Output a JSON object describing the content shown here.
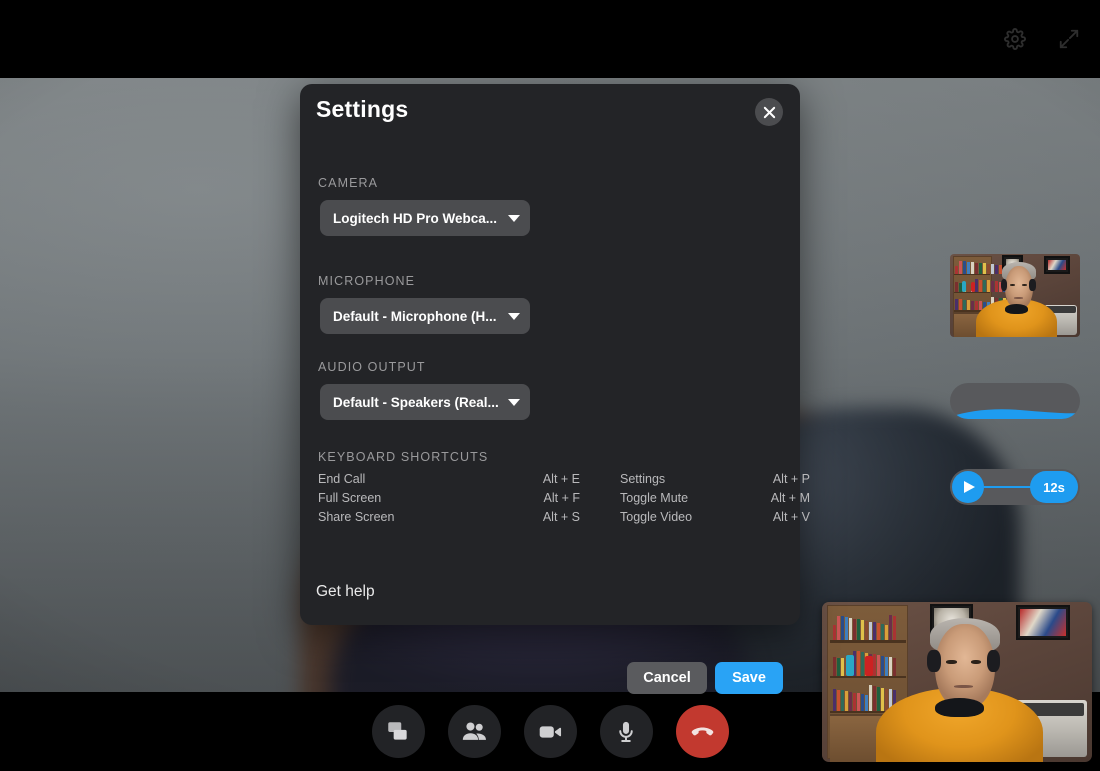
{
  "window": {
    "topbar": {
      "settings_icon": "gear-icon",
      "fullscreen_icon": "expand-arrows-icon"
    }
  },
  "call_controls": [
    {
      "name": "share-screen",
      "icon": "screen-share-icon",
      "label": "Share Screen",
      "style": "default"
    },
    {
      "name": "participants",
      "icon": "people-icon",
      "label": "Participants",
      "style": "default"
    },
    {
      "name": "toggle-video",
      "icon": "video-camera-icon",
      "label": "Toggle Video",
      "style": "default"
    },
    {
      "name": "toggle-mute",
      "icon": "microphone-icon",
      "label": "Toggle Mute",
      "style": "default"
    },
    {
      "name": "end-call",
      "icon": "phone-hangup-icon",
      "label": "End Call",
      "style": "danger"
    }
  ],
  "modal": {
    "title": "Settings",
    "close_label": "×",
    "close_icon": "close-icon",
    "camera": {
      "label": "CAMERA",
      "selected": "Logitech HD Pro Webca...",
      "caret_icon": "chevron-down-icon",
      "preview_name": "camera-preview"
    },
    "microphone": {
      "label": "MICROPHONE",
      "selected": "Default - Microphone (H...",
      "caret_icon": "chevron-down-icon",
      "meter_name": "mic-level-meter"
    },
    "audio_output": {
      "label": "AUDIO OUTPUT",
      "selected": "Default - Speakers (Real...",
      "caret_icon": "chevron-down-icon",
      "play_icon": "play-icon",
      "duration": "12s"
    },
    "shortcuts": {
      "label": "KEYBOARD SHORTCUTS",
      "rows": [
        {
          "left_name": "End Call",
          "left_key": "Alt + E",
          "right_name": "Settings",
          "right_key": "Alt + P"
        },
        {
          "left_name": "Full Screen",
          "left_key": "Alt + F",
          "right_name": "Toggle Mute",
          "right_key": "Alt + M"
        },
        {
          "left_name": "Share Screen",
          "left_key": "Alt + S",
          "right_name": "Toggle Video",
          "right_key": "Alt + V"
        }
      ]
    },
    "footer": {
      "help": "Get help",
      "cancel": "Cancel",
      "save": "Save"
    }
  },
  "colors": {
    "accent": "#1e9cf0",
    "save_button": "#29a3f5",
    "danger": "#c2392f",
    "modal_bg": "#232427",
    "control_bg": "#4b4c4f"
  }
}
